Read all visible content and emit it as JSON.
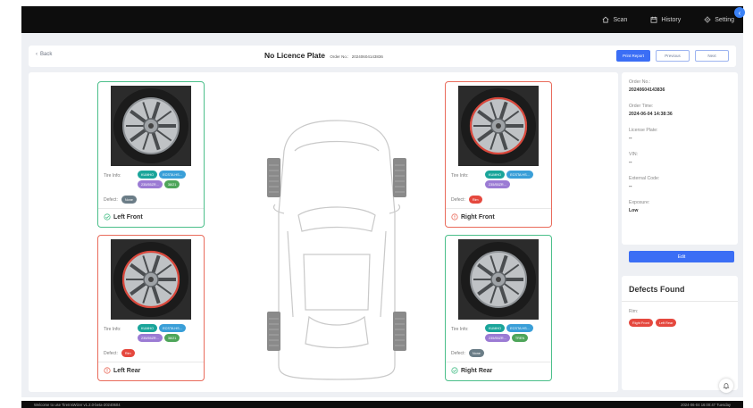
{
  "topnav": {
    "scan": "Scan",
    "history": "History",
    "setting": "Setting"
  },
  "header": {
    "back": "Back",
    "title": "No Licence Plate",
    "order_no_label": "Order No.:",
    "order_no": "20240604143836",
    "print_report": "Print Report",
    "previous": "Previous",
    "next": "Next"
  },
  "tires": {
    "lf": {
      "name": "Left Front",
      "status": "ok",
      "info_label": "Tire Info:",
      "defect_label": "Defect:",
      "chips": [
        "KUMHO",
        "ECSTA HS...",
        "235/55ZR...",
        "38/21"
      ],
      "defect": "None"
    },
    "rf": {
      "name": "Right Front",
      "status": "bad",
      "info_label": "Tire Info:",
      "defect_label": "Defect:",
      "chips": [
        "KUMHO",
        "ECSTA HS...",
        "235/55ZR..."
      ],
      "defect": "Rim"
    },
    "lr": {
      "name": "Left Rear",
      "status": "bad",
      "info_label": "Tire Info:",
      "defect_label": "Defect:",
      "chips": [
        "KUMHO",
        "ECSTA HS...",
        "235/55ZR...",
        "38/21"
      ],
      "defect": "Rim"
    },
    "rr": {
      "name": "Right Rear",
      "status": "ok",
      "info_label": "Tire Info:",
      "defect_label": "Defect:",
      "chips": [
        "KUMHO",
        "ECSTA HS...",
        "235/55ZR...",
        "TREN"
      ],
      "defect": "None"
    }
  },
  "sidebar": {
    "order_no_label": "Order No.:",
    "order_no": "20240604143836",
    "order_time_label": "Order Time:",
    "order_time": "2024-06-04 14:38:36",
    "license_plate_label": "License Plate:",
    "license_plate": "--",
    "vin_label": "VIN:",
    "vin": "--",
    "external_code_label": "External Code:",
    "external_code": "--",
    "exposure_label": "Exposure:",
    "exposure": "Low",
    "edit": "Edit"
  },
  "defects_found": {
    "title": "Defects Found",
    "rim_label": "Rim:",
    "items": [
      "Right Front",
      "Left Rear"
    ]
  },
  "status_bar": {
    "left": "Welcome to use TireInsWizer v1.2.0-beta-20240604",
    "right": "2024-06-04 16:00:47 Tuesday"
  },
  "colors": {
    "ok_border": "#4bbf8a",
    "bad_border": "#e96b5b",
    "primary": "#3b6ef5",
    "chip_kumho": "#1aa59a",
    "chip_model": "#3a9fd8",
    "chip_size": "#9b7bd4",
    "chip_extra": "#4ea55a",
    "chip_none": "#6b7d87",
    "chip_rim": "#e5483e"
  },
  "icons": {
    "scan": "home-icon",
    "history": "calendar-icon",
    "setting": "gear-icon",
    "ok": "check-circle-icon",
    "bad": "alert-circle-icon",
    "bell": "bell-icon"
  }
}
